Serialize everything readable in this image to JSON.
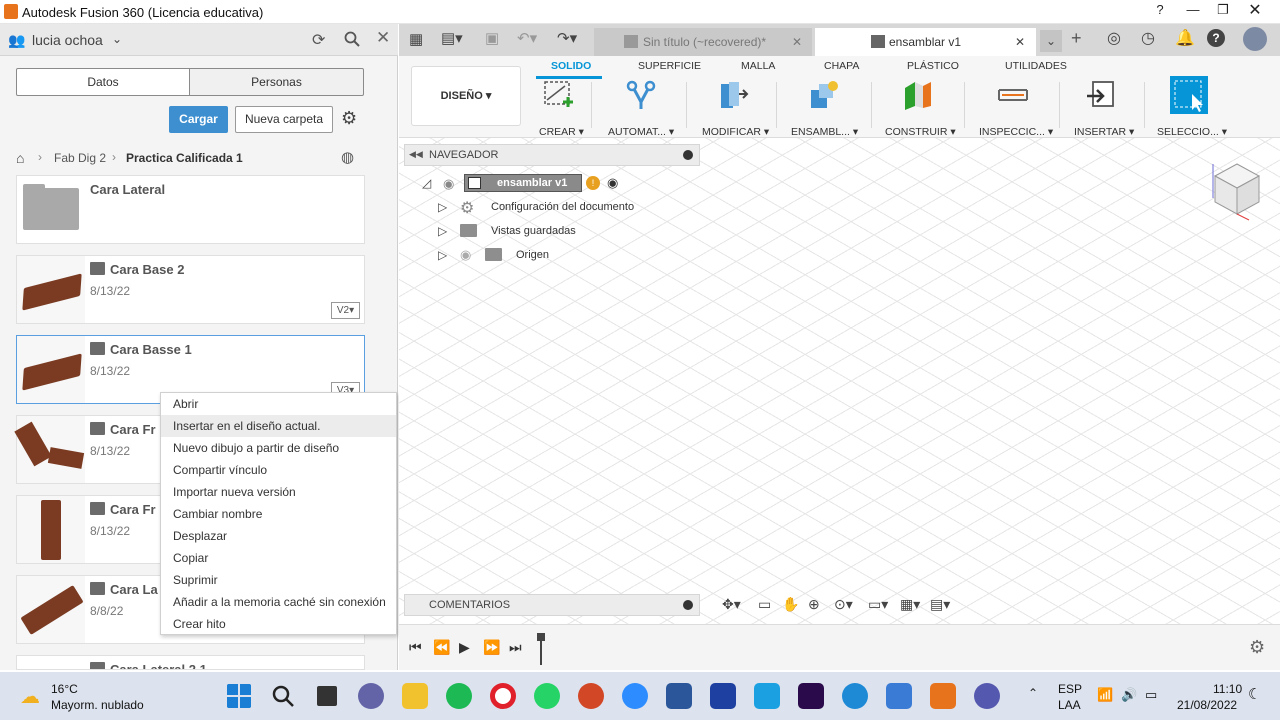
{
  "window": {
    "title": "Autodesk Fusion 360 (Licencia educativa)"
  },
  "left_panel": {
    "user": "lucia ochoa",
    "seg_tabs": [
      "Datos",
      "Personas"
    ],
    "upload_label": "Cargar",
    "new_folder_label": "Nueva carpeta",
    "breadcrumb": {
      "project": "Fab Dig 2",
      "folder": "Practica Calificada 1"
    },
    "items": [
      {
        "name": "Cara Lateral",
        "date": "",
        "version": ""
      },
      {
        "name": "Cara Base 2",
        "date": "8/13/22",
        "version": "V2▾"
      },
      {
        "name": "Cara Basse 1",
        "date": "8/13/22",
        "version": "V3▾"
      },
      {
        "name": "Cara Fr",
        "date": "8/13/22",
        "version": ""
      },
      {
        "name": "Cara Fr",
        "date": "8/13/22",
        "version": ""
      },
      {
        "name": "Cara La",
        "date": "8/8/22",
        "version": ""
      },
      {
        "name": "Cara Lateral 2 1",
        "date": "",
        "version": ""
      }
    ]
  },
  "context_menu": {
    "items": [
      "Abrir",
      "Insertar en el diseño actual.",
      "Nuevo dibujo a partir de diseño",
      "Compartir vínculo",
      "Importar nueva versión",
      "Cambiar nombre",
      "Desplazar",
      "Copiar",
      "Suprimir",
      "Añadir a la memoria caché sin conexión",
      "Crear hito"
    ],
    "highlighted_index": 1
  },
  "doc_tabs": [
    {
      "label": "Sin título (~recovered)*",
      "active": false
    },
    {
      "label": "ensamblar v1",
      "active": true
    }
  ],
  "ribbon": {
    "workspace": "DISEÑO ▾",
    "tabs": [
      "SOLIDO",
      "SUPERFICIE",
      "MALLA",
      "CHAPA",
      "PLÁSTICO",
      "UTILIDADES"
    ],
    "active_tab": "SOLIDO",
    "groups": [
      "CREAR ▾",
      "AUTOMAT... ▾",
      "MODIFICAR ▾",
      "ENSAMBL... ▾",
      "CONSTRUIR ▾",
      "INSPECCIC... ▾",
      "INSERTAR ▾",
      "SELECCIO... ▾"
    ]
  },
  "navigator": {
    "title": "NAVEGADOR",
    "root": "ensamblar v1",
    "nodes": [
      "Configuración del documento",
      "Vistas guardadas",
      "Origen"
    ]
  },
  "comments": {
    "title": "COMENTARIOS"
  },
  "taskbar": {
    "weather_temp": "16°C",
    "weather_desc": "Mayorm. nublado",
    "lang": "ESP",
    "region": "LAA",
    "time": "11:10",
    "date": "21/08/2022"
  },
  "colors": {
    "accent_blue": "#0696d7",
    "upload_btn": "#3d8fd0",
    "fusion_orange": "#e8731d",
    "active_tab_underline": "#0696d7"
  }
}
